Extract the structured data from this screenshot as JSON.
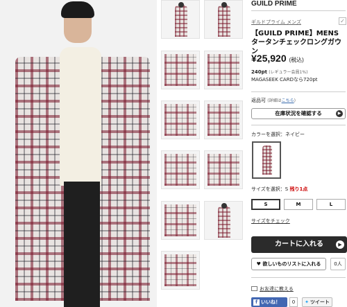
{
  "brand": {
    "name": "GUILD PRIME",
    "kana": "ギルドプライム メンズ"
  },
  "product": {
    "title": "【GUILD PRIME】MENS タータンチェックロングガウン",
    "price": "¥25,920",
    "tax_label": "(税込)",
    "points": "240pt",
    "points_note": "(レギュラー会員1%)",
    "card_points": "MAGASEEK CARDなら720pt"
  },
  "returns": {
    "label": "返品可",
    "detail_prefix": "(詳細は",
    "detail_link": "こちら",
    "detail_suffix": ")"
  },
  "buttons": {
    "stock_check": "在庫状況を確認する",
    "add_to_cart": "カートに入れる",
    "wishlist": "欲しいものリストに入れる",
    "wishlist_count": "0人",
    "tell_friend": "お友達に教える",
    "like": "いいね！",
    "like_count": "0",
    "tweet": "ツイート"
  },
  "color": {
    "label": "カラーを選択：ネイビー"
  },
  "size": {
    "label_prefix": "サイズを選択：S",
    "stock": "残り1点",
    "options": [
      "S",
      "M",
      "L"
    ],
    "selected": "S",
    "check_link": "サイズをチェック"
  },
  "icons": [
    "check-icon",
    "arrow-right-icon",
    "heart-icon",
    "mail-icon",
    "facebook-icon",
    "twitter-icon"
  ],
  "colors": {
    "cart_bg": "#2b2b2b",
    "stock_red": "#cc0000",
    "facebook": "#4267b2"
  }
}
